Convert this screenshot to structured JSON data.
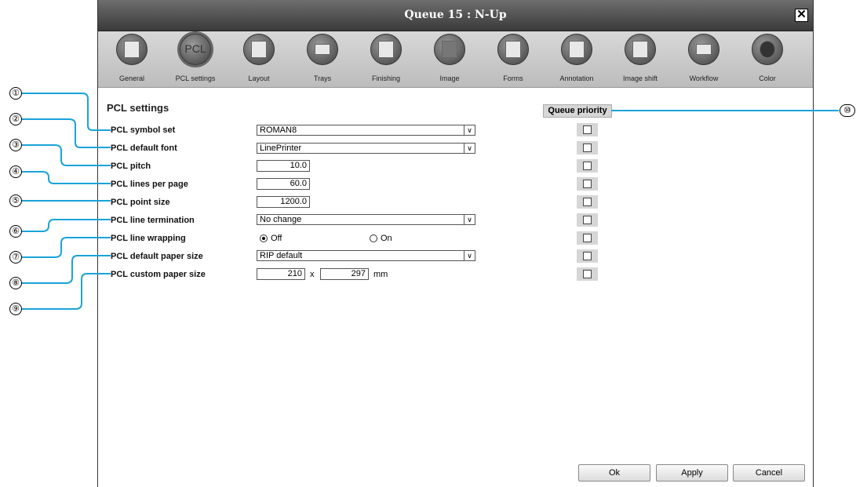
{
  "window": {
    "title": "Queue 15 : N-Up"
  },
  "toolbar": {
    "items": [
      {
        "label": "General",
        "icon": "general-icon",
        "glyph": "📄"
      },
      {
        "label": "PCL settings",
        "icon": "pcl-settings-icon",
        "glyph": "PCL"
      },
      {
        "label": "Layout",
        "icon": "layout-icon",
        "glyph": "▦"
      },
      {
        "label": "Trays",
        "icon": "trays-icon",
        "glyph": "≡"
      },
      {
        "label": "Finishing",
        "icon": "finishing-icon",
        "glyph": "▤"
      },
      {
        "label": "Image",
        "icon": "image-icon",
        "glyph": "▩"
      },
      {
        "label": "Forms",
        "icon": "forms-icon",
        "glyph": "▣"
      },
      {
        "label": "Annotation",
        "icon": "annotation-icon",
        "glyph": "✎"
      },
      {
        "label": "Image shift",
        "icon": "image-shift-icon",
        "glyph": "⇕"
      },
      {
        "label": "Workflow",
        "icon": "workflow-icon",
        "glyph": "✉"
      },
      {
        "label": "Color",
        "icon": "color-icon",
        "glyph": "◉"
      }
    ],
    "active_index": 1
  },
  "form": {
    "heading": "PCL settings",
    "queue_priority": "Queue priority",
    "symbol_set": {
      "label": "PCL symbol set",
      "value": "ROMAN8"
    },
    "default_font": {
      "label": "PCL default font",
      "value": "LinePrinter"
    },
    "pitch": {
      "label": "PCL pitch",
      "value": "10.0"
    },
    "lines_per_page": {
      "label": "PCL lines per page",
      "value": "60.0"
    },
    "point_size": {
      "label": "PCL point size",
      "value": "1200.0"
    },
    "line_termination": {
      "label": "PCL line termination",
      "value": "No change"
    },
    "line_wrapping": {
      "label": "PCL line wrapping",
      "off": "Off",
      "on": "On",
      "selected": "Off"
    },
    "default_paper_size": {
      "label": "PCL default paper size",
      "value": "RIP default"
    },
    "custom_paper_size": {
      "label": "PCL custom paper size",
      "width": "210",
      "height": "297",
      "separator": "x",
      "unit": "mm"
    }
  },
  "buttons": {
    "ok": "Ok",
    "apply": "Apply",
    "cancel": "Cancel"
  },
  "callouts": [
    "①",
    "②",
    "③",
    "④",
    "⑤",
    "⑥",
    "⑦",
    "⑧",
    "⑨",
    "⑩"
  ],
  "colors": {
    "leader": "#1aa3d9",
    "titlebar": "#4a4a4a",
    "toolbar": "#c8c8c8"
  }
}
